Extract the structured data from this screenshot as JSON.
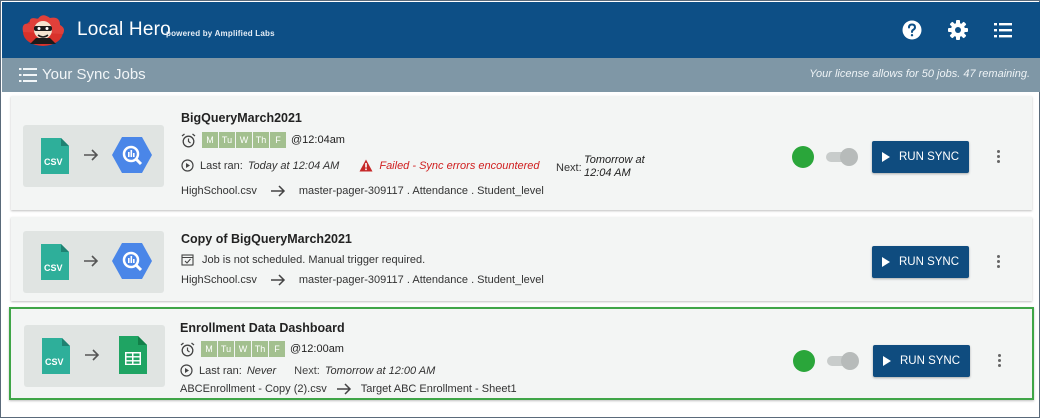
{
  "app": {
    "brand": "Local Hero",
    "powered_by": "powered by Amplified Labs"
  },
  "subheader": {
    "title": "Your Sync Jobs",
    "license": "Your license allows for 50 jobs. 47 remaining."
  },
  "jobs": [
    {
      "title": "BigQueryMarch2021",
      "source_icon": "csv-file-icon",
      "source_label": "CSV",
      "dest_icon": "bigquery-icon",
      "days": [
        "M",
        "Tu",
        "W",
        "Th",
        "F"
      ],
      "time": "@12:04am",
      "last_ran_label": "Last ran:",
      "last_ran": "Today at 12:04 AM",
      "error": "Failed - Sync errors encountered",
      "next_label": "Next:",
      "next_line1": "Tomorrow at",
      "next_line2": "12:04 AM",
      "source_file": "HighSchool.csv",
      "destination": "master-pager-309117 . Attendance . Student_level",
      "status": "active",
      "run_label": "RUN SYNC"
    },
    {
      "title": "Copy of BigQueryMarch2021",
      "source_icon": "csv-file-icon",
      "source_label": "CSV",
      "dest_icon": "bigquery-icon",
      "schedule_note": "Job is not scheduled. Manual trigger required.",
      "source_file": "HighSchool.csv",
      "destination": "master-pager-309117 . Attendance . Student_level",
      "run_label": "RUN SYNC"
    },
    {
      "title": "Enrollment Data Dashboard",
      "source_icon": "csv-file-icon",
      "source_label": "CSV",
      "dest_icon": "google-sheets-icon",
      "days": [
        "M",
        "Tu",
        "W",
        "Th",
        "F"
      ],
      "time": "@12:00am",
      "last_ran_label": "Last ran:",
      "last_ran": "Never",
      "next_label": "Next:",
      "next": "Tomorrow at 12:00 AM",
      "source_file": "ABCEnrollment - Copy (2).csv",
      "destination": "Target ABC Enrollment - Sheet1",
      "status": "active",
      "run_label": "RUN SYNC"
    }
  ],
  "colors": {
    "header": "#0d4f86",
    "subheader": "#7f97a6",
    "button": "#0f4c7f",
    "day_chip": "#a3c08f",
    "status_green": "#2aa63a",
    "error_red": "#d02020",
    "selected_border": "#3fa547"
  }
}
